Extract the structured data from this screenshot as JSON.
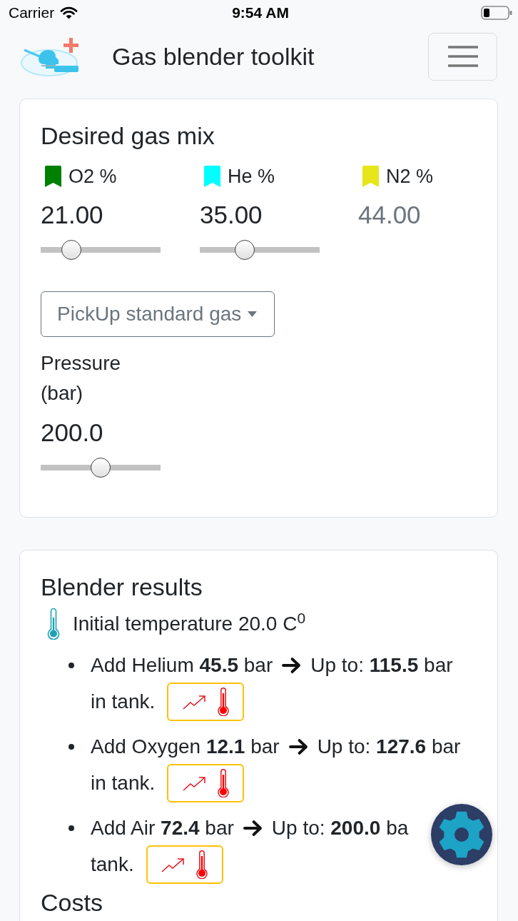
{
  "status_bar": {
    "carrier": "Carrier",
    "time": "9:54 AM"
  },
  "navbar": {
    "title": "Gas blender toolkit"
  },
  "desired_mix": {
    "title": "Desired gas mix",
    "gases": [
      {
        "kind": "slider",
        "label": "O2 %",
        "color": "#008000",
        "value": "21.00",
        "level": 0.21
      },
      {
        "kind": "slider",
        "label": "He %",
        "color": "#00ffff",
        "value": "35.00",
        "level": 0.35
      },
      {
        "kind": "computed",
        "label": "N2 %",
        "color": "#e6e619",
        "value": "44.00"
      }
    ],
    "standard_gas": {
      "label": "PickUp standard gas"
    },
    "pressure": {
      "label": "Pressure (bar)",
      "value": "200.0",
      "level": 0.5
    }
  },
  "blender_results": {
    "title": "Blender results",
    "initial_temperature": "Initial temperature 20.0 C$^{0}$",
    "steps": [
      {
        "text": "Add Helium **45.5** bar",
        "target": "Up to: **115.5** bar",
        "continued": "in tank."
      },
      {
        "text": "Add Oxygen **12.1** bar",
        "target": "Up to: **127.6** bar",
        "continued": "in tank."
      },
      {
        "text": "Add Air **72.4** bar",
        "target": "Up to: **200.0** ba",
        "continued": "tank."
      }
    ]
  },
  "costs": {
    "title": "Costs"
  }
}
